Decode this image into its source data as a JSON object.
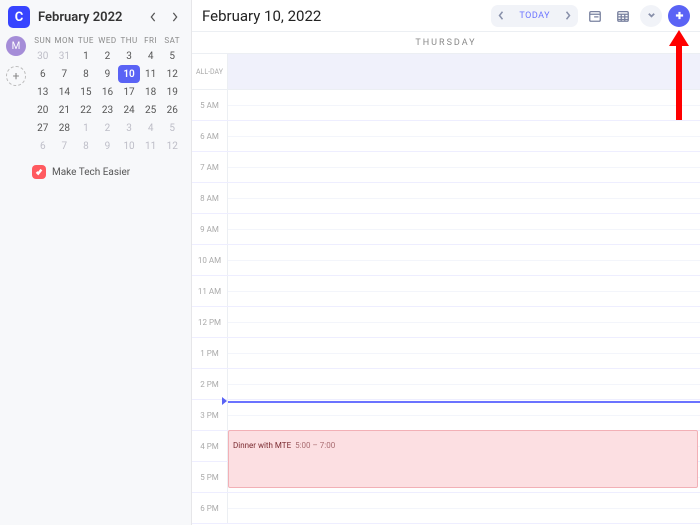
{
  "sidebar": {
    "app_letter": "C",
    "month_title": "February 2022",
    "dow": [
      "SUN",
      "MON",
      "TUE",
      "WED",
      "THU",
      "FRI",
      "SAT"
    ],
    "avatar_letter": "M",
    "calendars": [
      {
        "name": "Make Tech Easier",
        "color": "#ff5a5f",
        "checked": true
      }
    ],
    "mini": {
      "selected": 10,
      "rows": [
        [
          {
            "d": 30,
            "o": true
          },
          {
            "d": 31,
            "o": true
          },
          {
            "d": 1
          },
          {
            "d": 2
          },
          {
            "d": 3
          },
          {
            "d": 4
          },
          {
            "d": 5
          }
        ],
        [
          {
            "d": 6
          },
          {
            "d": 7
          },
          {
            "d": 8
          },
          {
            "d": 9
          },
          {
            "d": 10,
            "sel": true
          },
          {
            "d": 11
          },
          {
            "d": 12
          }
        ],
        [
          {
            "d": 13
          },
          {
            "d": 14
          },
          {
            "d": 15
          },
          {
            "d": 16
          },
          {
            "d": 17
          },
          {
            "d": 18
          },
          {
            "d": 19
          }
        ],
        [
          {
            "d": 20
          },
          {
            "d": 21
          },
          {
            "d": 22
          },
          {
            "d": 23
          },
          {
            "d": 24
          },
          {
            "d": 25
          },
          {
            "d": 26
          }
        ],
        [
          {
            "d": 27
          },
          {
            "d": 28
          },
          {
            "d": 1,
            "o": true
          },
          {
            "d": 2,
            "o": true
          },
          {
            "d": 3,
            "o": true
          },
          {
            "d": 4,
            "o": true
          },
          {
            "d": 5,
            "o": true
          }
        ],
        [
          {
            "d": 6,
            "o": true
          },
          {
            "d": 7,
            "o": true
          },
          {
            "d": 8,
            "o": true
          },
          {
            "d": 9,
            "o": true
          },
          {
            "d": 10,
            "o": true
          },
          {
            "d": 11,
            "o": true
          },
          {
            "d": 12,
            "o": true
          }
        ]
      ]
    }
  },
  "topbar": {
    "date": "February 10, 2022",
    "today_label": "TODAY"
  },
  "day": {
    "weekday": "THURSDAY",
    "allday_label": "ALL-DAY",
    "hours": [
      "5 AM",
      "6 AM",
      "7 AM",
      "8 AM",
      "9 AM",
      "10 AM",
      "11 AM",
      "12 PM",
      "1 PM",
      "2 PM",
      "3 PM",
      "4 PM",
      "5 PM",
      "6 PM"
    ]
  },
  "event": {
    "title": "Dinner with MTE",
    "time": "5:00 – 7:00"
  },
  "colors": {
    "accent": "#5a63f5",
    "event_bg": "#fcdfe2",
    "annotation": "#ff0000"
  }
}
